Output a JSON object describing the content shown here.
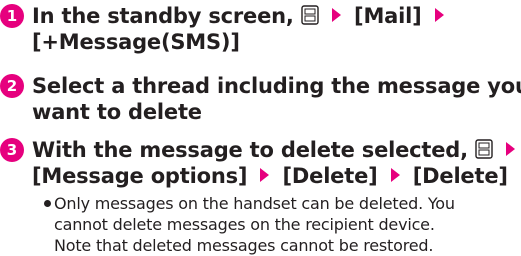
{
  "steps": [
    {
      "number": "1",
      "line1_text": "In the standby screen,",
      "line1_item": "[Mail]",
      "line2_text": "[+Message(SMS)]"
    },
    {
      "number": "2",
      "line1_text": "Select a thread including the message you",
      "line2_text": "want to delete"
    },
    {
      "number": "3",
      "line1_text": "With the message to delete selected,",
      "line2_item1": "[Message options]",
      "line2_item2": "[Delete]",
      "line2_item3": "[Delete]"
    }
  ],
  "note": {
    "line1": "Only messages on the handset can be deleted. You",
    "line2": "cannot delete messages on the recipient device.",
    "line3": "Note that deleted messages cannot be restored."
  },
  "icons": {
    "menu_key": "menu-key-icon",
    "arrow": "right-triangle-arrow-icon"
  },
  "colors": {
    "accent": "#e6007e",
    "text": "#231f20"
  }
}
